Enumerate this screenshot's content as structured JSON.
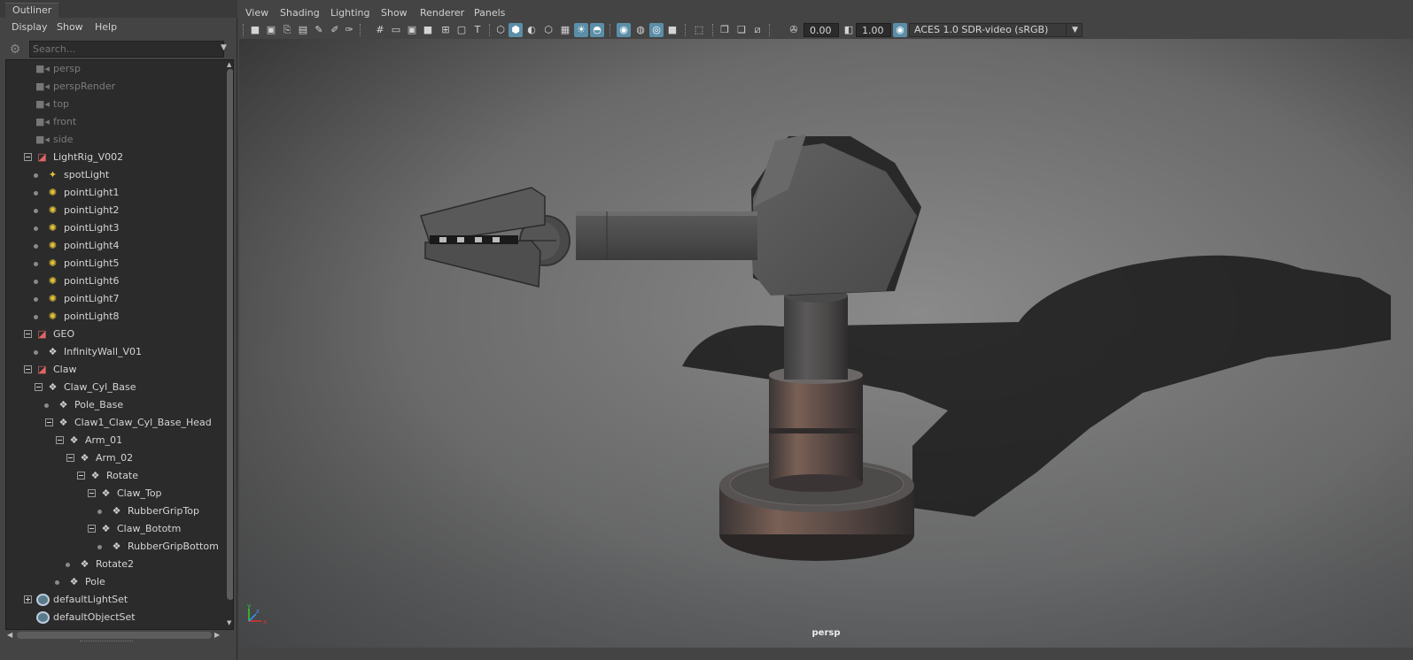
{
  "outliner": {
    "tab_label": "Outliner",
    "menus": [
      "Display",
      "Show",
      "Help"
    ],
    "search_placeholder": "Search...",
    "items": [
      {
        "label": "persp",
        "icon": "camera-icon",
        "dim": true
      },
      {
        "label": "perspRender",
        "icon": "camera-icon",
        "dim": true
      },
      {
        "label": "top",
        "icon": "camera-icon",
        "dim": true
      },
      {
        "label": "front",
        "icon": "camera-icon",
        "dim": true
      },
      {
        "label": "side",
        "icon": "camera-icon",
        "dim": true
      },
      {
        "label": "LightRig_V002",
        "icon": "group-icon"
      },
      {
        "label": "spotLight",
        "icon": "spotlight-icon"
      },
      {
        "label": "pointLight1",
        "icon": "pointlight-icon"
      },
      {
        "label": "pointLight2",
        "icon": "pointlight-icon"
      },
      {
        "label": "pointLight3",
        "icon": "pointlight-icon"
      },
      {
        "label": "pointLight4",
        "icon": "pointlight-icon"
      },
      {
        "label": "pointLight5",
        "icon": "pointlight-icon"
      },
      {
        "label": "pointLight6",
        "icon": "pointlight-icon"
      },
      {
        "label": "pointLight7",
        "icon": "pointlight-icon"
      },
      {
        "label": "pointLight8",
        "icon": "pointlight-icon"
      },
      {
        "label": "GEO",
        "icon": "group-icon"
      },
      {
        "label": "InfinityWall_V01",
        "icon": "mesh-icon"
      },
      {
        "label": "Claw",
        "icon": "group-icon"
      },
      {
        "label": "Claw_Cyl_Base",
        "icon": "mesh-icon"
      },
      {
        "label": "Pole_Base",
        "icon": "mesh-icon"
      },
      {
        "label": "Claw1_Claw_Cyl_Base_Head",
        "icon": "mesh-icon"
      },
      {
        "label": "Arm_01",
        "icon": "mesh-icon"
      },
      {
        "label": "Arm_02",
        "icon": "mesh-icon"
      },
      {
        "label": "Rotate",
        "icon": "mesh-icon"
      },
      {
        "label": "Claw_Top",
        "icon": "mesh-icon"
      },
      {
        "label": "RubberGripTop",
        "icon": "mesh-icon"
      },
      {
        "label": "Claw_Bototm",
        "icon": "mesh-icon"
      },
      {
        "label": "RubberGripBottom",
        "icon": "mesh-icon"
      },
      {
        "label": "Rotate2",
        "icon": "mesh-icon"
      },
      {
        "label": "Pole",
        "icon": "mesh-icon"
      },
      {
        "label": "defaultLightSet",
        "icon": "set-icon"
      },
      {
        "label": "defaultObjectSet",
        "icon": "set-icon"
      }
    ]
  },
  "viewport": {
    "menus": [
      "View",
      "Shading",
      "Lighting",
      "Show",
      "Renderer",
      "Panels"
    ],
    "exposure": "0.00",
    "gamma": "1.00",
    "color_space": "ACES 1.0 SDR-video (sRGB)",
    "camera_label": "persp",
    "axis": {
      "x": "x",
      "y": "y",
      "z": "z"
    }
  }
}
